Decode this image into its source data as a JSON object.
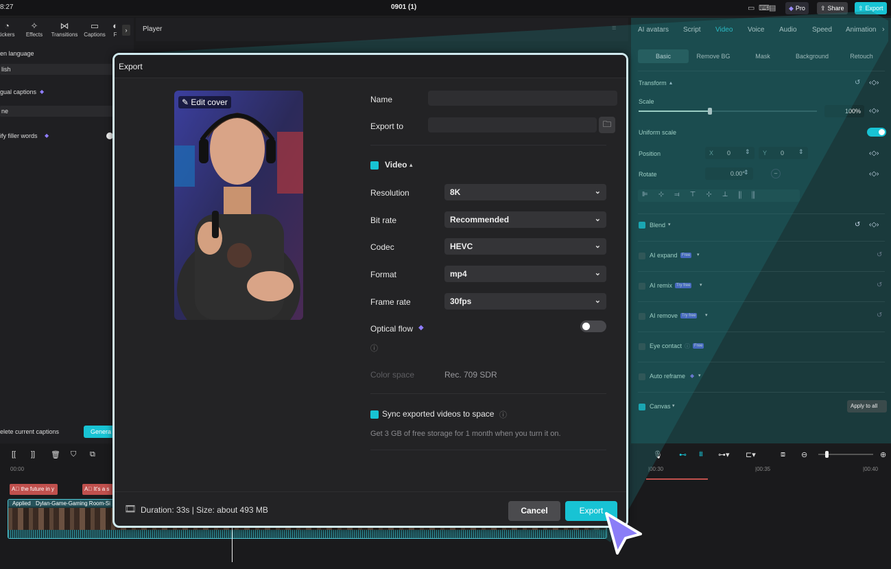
{
  "topbar": {
    "time": "8:27",
    "title": "0901 (1)",
    "pro_label": "Pro",
    "share_label": "Share",
    "export_label": "Export"
  },
  "left_panel": {
    "tools": [
      {
        "label": "tickers",
        "icon": "sticker-icon"
      },
      {
        "label": "Effects",
        "icon": "effects-icon"
      },
      {
        "label": "Transitions",
        "icon": "transitions-icon"
      },
      {
        "label": "Captions",
        "icon": "captions-icon"
      },
      {
        "label": "F",
        "icon": "filter-icon"
      }
    ],
    "spoken_language_label": "en language",
    "spoken_language_value": "lish",
    "bilingual_label": "gual captions",
    "bilingual_value": "ne",
    "filler_label": "ify filler words",
    "delete_label": "elete current captions",
    "generate_label": "Genera"
  },
  "player": {
    "title": "Player"
  },
  "right_panel": {
    "tabs": [
      "AI avatars",
      "Script",
      "Video",
      "Voice",
      "Audio",
      "Speed",
      "Animation"
    ],
    "active_tab": "Video",
    "subtabs": [
      "Basic",
      "Remove BG",
      "Mask",
      "Background",
      "Retouch"
    ],
    "active_subtab": "Basic",
    "transform_label": "Transform",
    "scale_label": "Scale",
    "scale_value": "100%",
    "scale_level": 0.4,
    "uniform_scale_label": "Uniform scale",
    "position_label": "Position",
    "pos_x_label": "X",
    "pos_x": "0",
    "pos_y_label": "Y",
    "pos_y": "0",
    "rotate_label": "Rotate",
    "rotate_value": "0.00°",
    "blend_label": "Blend",
    "ai_expand_label": "AI expand",
    "ai_remix_label": "AI remix",
    "ai_remove_label": "AI remove",
    "eye_contact_label": "Eye contact",
    "auto_reframe_label": "Auto reframe",
    "canvas_label": "Canvas",
    "free_badge": "Free",
    "try_free_badge": "Try free",
    "apply_all_label": "Apply to all"
  },
  "timeline": {
    "time_start": "00:00",
    "time_30": "|00:30",
    "time_35": "|00:35",
    "time_40": "|00:40",
    "caption1": "the future in y",
    "caption2": "It's a s",
    "clip_applied": "Applied",
    "clip_name": "Dylan-Game-Gaming Room-Si"
  },
  "export_dialog": {
    "title": "Export",
    "edit_cover_label": "Edit cover",
    "name_label": "Name",
    "name_value": "",
    "export_to_label": "Export to",
    "export_to_value": "",
    "video_section_label": "Video",
    "resolution_label": "Resolution",
    "resolution_value": "8K",
    "bitrate_label": "Bit rate",
    "bitrate_value": "Recommended",
    "codec_label": "Codec",
    "codec_value": "HEVC",
    "format_label": "Format",
    "format_value": "mp4",
    "framerate_label": "Frame rate",
    "framerate_value": "30fps",
    "optical_flow_label": "Optical flow",
    "color_space_label": "Color space",
    "color_space_value": "Rec. 709 SDR",
    "sync_label": "Sync exported videos to space",
    "sync_desc": "Get 3 GB of free storage for 1 month when you turn it on.",
    "footer_info": "Duration: 33s | Size: about 493 MB",
    "cancel_label": "Cancel",
    "export_label": "Export"
  },
  "colors": {
    "accent": "#18c3d4",
    "teal_panel": "#1a3a3c",
    "premium": "#7b6cf6",
    "cursor": "#8a7df7"
  }
}
